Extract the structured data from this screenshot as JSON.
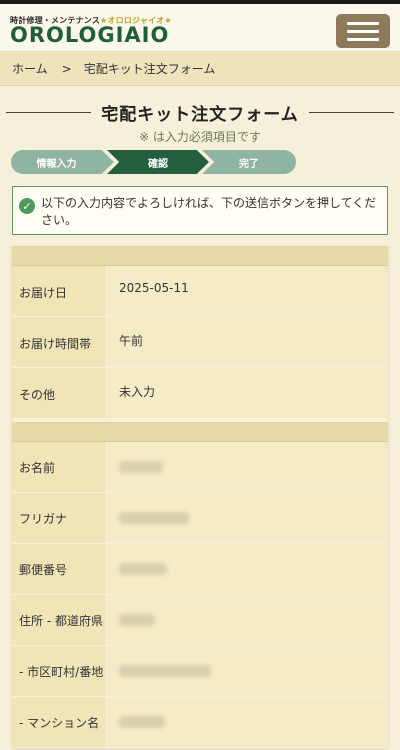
{
  "header": {
    "tagline_prefix": "時計修理・メンテナンス",
    "tagline_accent": "★オロロジャイオ★",
    "logo": "OROLOGIAIO",
    "menu_icon": "hamburger-icon"
  },
  "breadcrumb": {
    "home": "ホーム",
    "separator": ">",
    "current": "宅配キット注文フォーム"
  },
  "page": {
    "title": "宅配キット注文フォーム",
    "required_note": "※ は入力必須項目です"
  },
  "steps": [
    {
      "label": "情報入力",
      "state": "done"
    },
    {
      "label": "確認",
      "state": "active"
    },
    {
      "label": "完了",
      "state": "pending"
    }
  ],
  "notice": {
    "icon": "check-circle-icon",
    "text": "以下の入力内容でよろしければ、下の送信ボタンを押してください。"
  },
  "delivery": {
    "rows": [
      {
        "label": "お届け日",
        "value": "2025-05-11"
      },
      {
        "label": "お届け時間帯",
        "value": "午前"
      },
      {
        "label": "その他",
        "value": "未入力"
      }
    ]
  },
  "customer": {
    "rows": [
      {
        "label": "お名前"
      },
      {
        "label": "フリガナ"
      },
      {
        "label": "郵便番号"
      },
      {
        "label": "住所 - 都道府県"
      },
      {
        "label": "- 市区町村/番地"
      },
      {
        "label": "- マンション名"
      }
    ]
  },
  "colors": {
    "brand_green": "#1f5e3a",
    "step_active": "#235f3f",
    "step_inactive": "#8fb4a2",
    "menu_button": "#8c7a58"
  }
}
